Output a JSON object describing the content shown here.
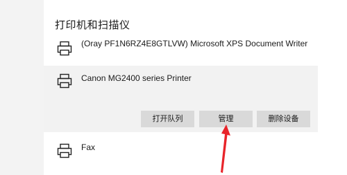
{
  "section": {
    "title": "打印机和扫描仪"
  },
  "printers": [
    {
      "name": "(Oray PF1N6RZ4E8GTLVW) Microsoft XPS Document Writer",
      "icon": "printer-icon"
    },
    {
      "name": "Canon MG2400 series Printer",
      "icon": "printer-icon",
      "selected": true
    },
    {
      "name": "Fax",
      "icon": "printer-icon"
    }
  ],
  "actions": {
    "open_queue": "打开队列",
    "manage": "管理",
    "remove_device": "删除设备"
  },
  "colors": {
    "annotation_arrow": "#e8242a",
    "selected_bg": "#f2f2f2",
    "button_bg": "#d9d9d9"
  }
}
